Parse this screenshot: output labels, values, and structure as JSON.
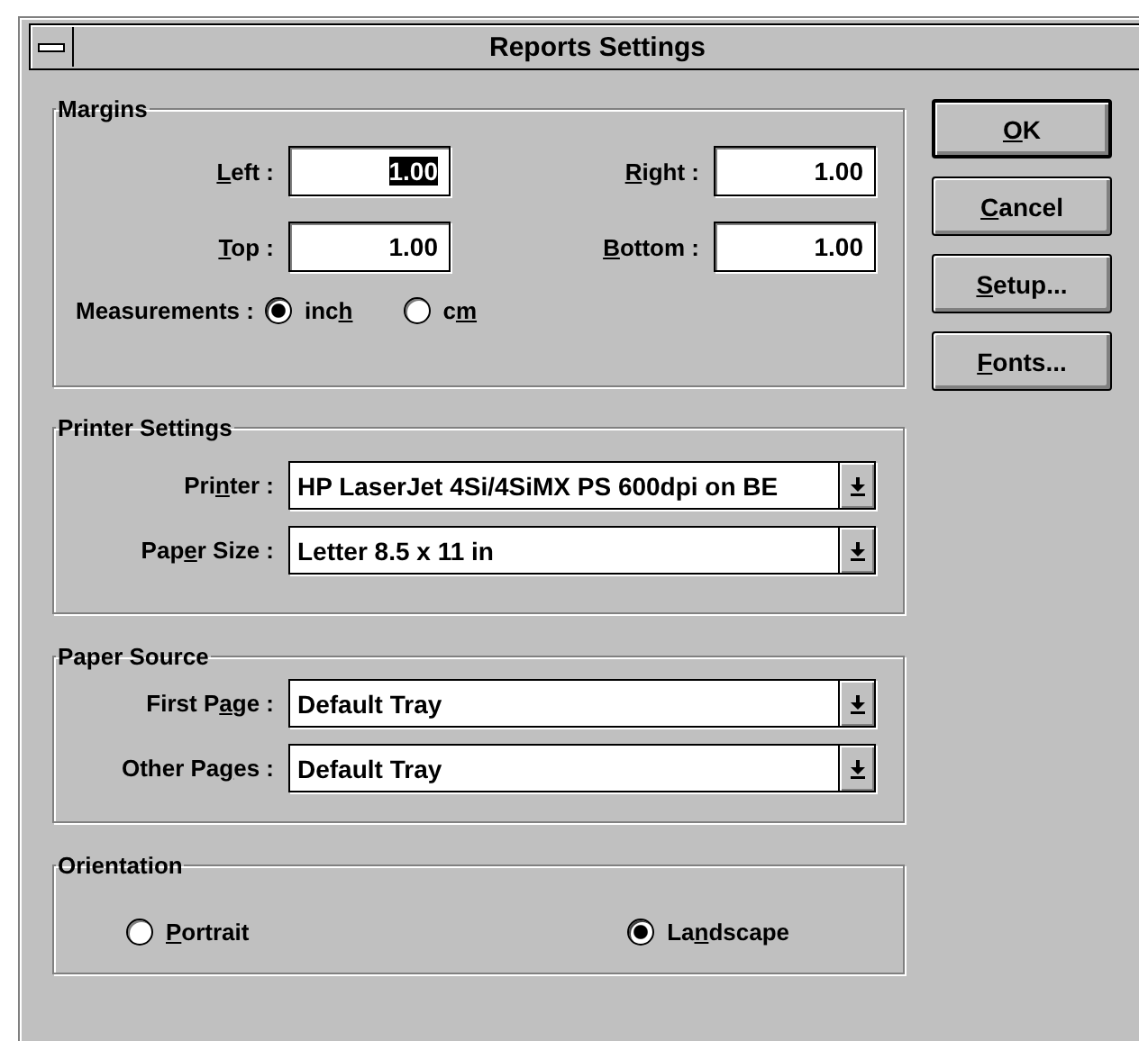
{
  "window": {
    "title": "Reports Settings"
  },
  "margins": {
    "title": "Margins",
    "fields": [
      {
        "label": {
          "key": "L",
          "after": "eft :"
        },
        "value": "1.00",
        "selected": true
      },
      {
        "label": {
          "key": "R",
          "after": "ight :"
        },
        "value": "1.00",
        "selected": false
      },
      {
        "label": {
          "key": "T",
          "after": "op :"
        },
        "value": "1.00",
        "selected": false
      },
      {
        "label": {
          "key": "B",
          "after": "ottom :"
        },
        "value": "1.00",
        "selected": false
      }
    ],
    "measurements": {
      "label": "Measurements :",
      "options": [
        {
          "label": {
            "before": "inc",
            "key": "h"
          },
          "selected": true
        },
        {
          "label": {
            "before": "c",
            "key": "m"
          },
          "selected": false
        }
      ]
    }
  },
  "printer_settings": {
    "title": "Printer Settings",
    "combos": [
      {
        "label": {
          "before": "Pri",
          "key": "n",
          "after": "ter :"
        },
        "value": "HP LaserJet 4Si/4SiMX PS 600dpi on BE"
      },
      {
        "label": {
          "before": "Pap",
          "key": "e",
          "after": "r Size :"
        },
        "value": "Letter 8.5 x 11 in"
      }
    ]
  },
  "paper_source": {
    "title": "Paper Source",
    "combos": [
      {
        "label": {
          "before": "First P",
          "key": "a",
          "after": "ge :"
        },
        "value": "Default Tray"
      },
      {
        "label": {
          "before": "Other Pa",
          "key": "g",
          "after": "es :"
        },
        "value": "Default Tray"
      }
    ]
  },
  "orientation": {
    "title": "Orientation",
    "options": [
      {
        "label": {
          "key": "P",
          "after": "ortrait"
        },
        "selected": false
      },
      {
        "label": {
          "before": "La",
          "key": "n",
          "after": "dscape"
        },
        "selected": true
      }
    ]
  },
  "buttons": [
    {
      "label": {
        "key": "O",
        "after": "K"
      },
      "default": true
    },
    {
      "label": {
        "key": "C",
        "after": "ancel"
      },
      "default": false
    },
    {
      "label": {
        "key": "S",
        "after": "etup..."
      },
      "default": false
    },
    {
      "label": {
        "key": "F",
        "after": "onts..."
      },
      "default": false
    }
  ]
}
